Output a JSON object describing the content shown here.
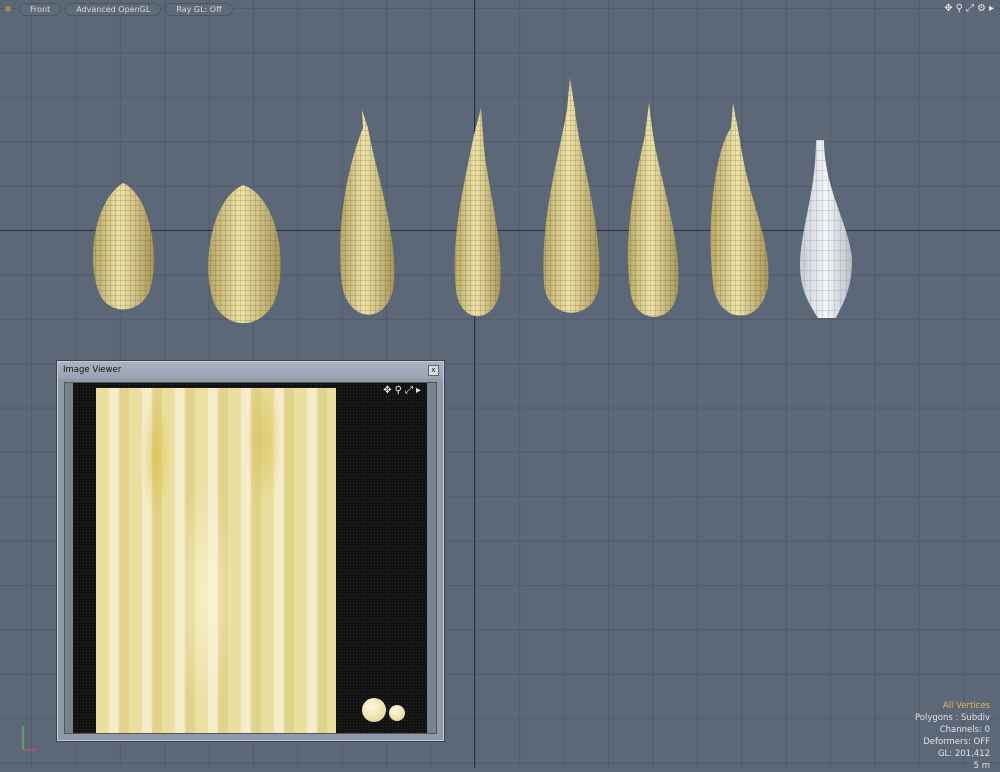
{
  "toolbar": {
    "buttons": [
      "Front",
      "Advanced OpenGL",
      "Ray GL: Off"
    ]
  },
  "viewport_icons": [
    "move-icon",
    "zoom-icon",
    "fit-icon",
    "gear-icon",
    "more-icon"
  ],
  "stats": {
    "selection": "All Vertices",
    "polygons": "Polygons : Subdiv",
    "channels": "Channels: 0",
    "deformers": "Deformers: OFF",
    "gl": "GL: 201,412",
    "scale": "5 m"
  },
  "image_viewer": {
    "title": "Image Viewer",
    "close": "x"
  },
  "colors": {
    "background": "#5c6777",
    "accent": "#e7b64a",
    "seed": "#d9c783"
  }
}
